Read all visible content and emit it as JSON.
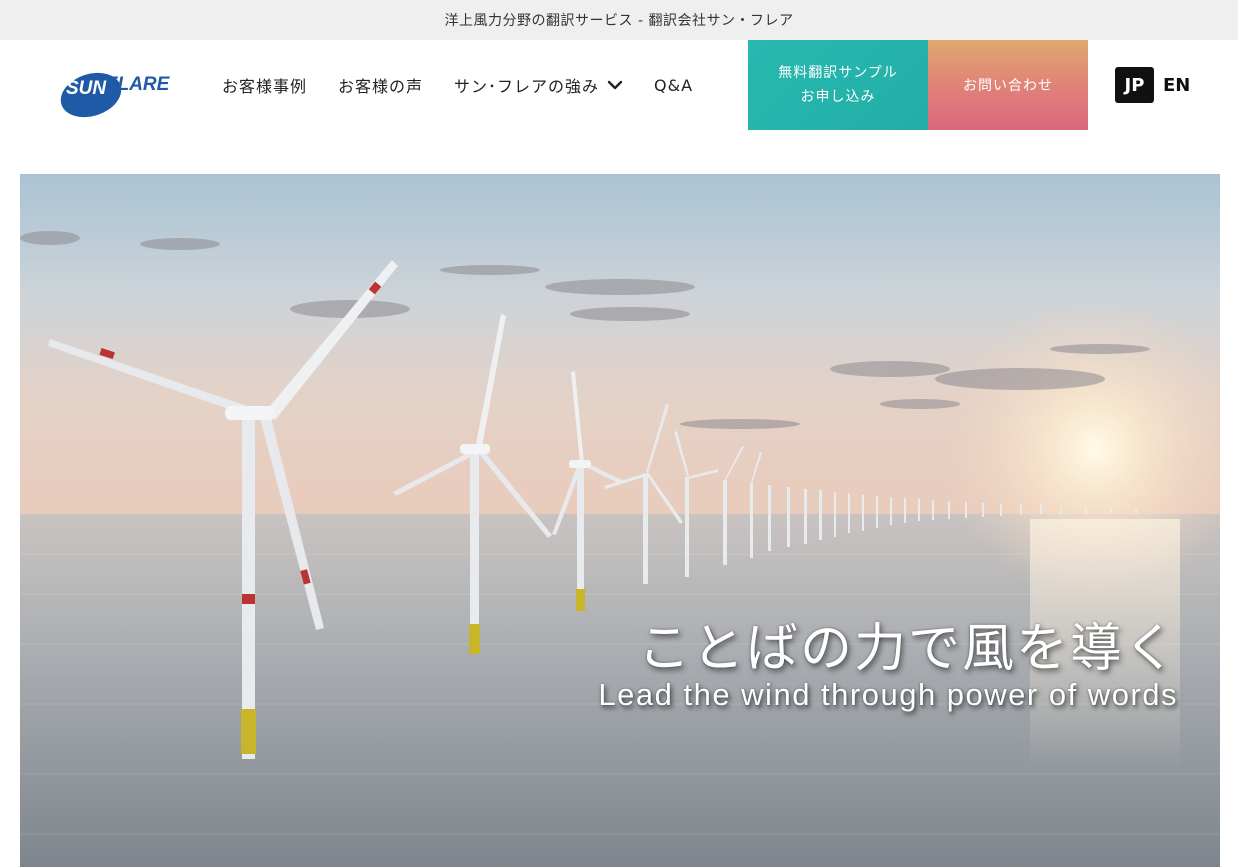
{
  "topbar": {
    "text": "洋上風力分野の翻訳サービス - 翻訳会社サン・フレア"
  },
  "logo": {
    "text": "SUNFLARE",
    "color": "#1f5aa6"
  },
  "nav": {
    "items": [
      {
        "label": "お客様事例"
      },
      {
        "label": "お客様の声"
      },
      {
        "label": "サン･フレアの強み",
        "has_dropdown": true
      },
      {
        "label": "Q&A"
      }
    ]
  },
  "cta": {
    "sample_line1": "無料翻訳サンプル",
    "sample_line2": "お申し込み",
    "contact": "お問い合わせ",
    "sample_color": "#22aea9",
    "contact_color": "#e0807a"
  },
  "lang": {
    "jp": "JP",
    "en": "EN",
    "active": "JP"
  },
  "hero": {
    "tagline_jp": "ことばの力で風を導く",
    "tagline_en": "Lead the wind through power of words"
  }
}
